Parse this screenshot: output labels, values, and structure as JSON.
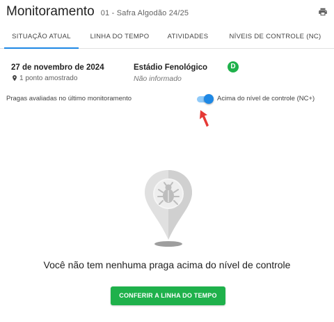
{
  "header": {
    "title": "Monitoramento",
    "subtitle": "01 - Safra Algodão 24/25",
    "print_icon": "printer-icon"
  },
  "tabs": [
    {
      "label": "SITUAÇÃO ATUAL",
      "active": true
    },
    {
      "label": "LINHA DO TEMPO",
      "active": false
    },
    {
      "label": "ATIVIDADES",
      "active": false
    },
    {
      "label": "NÍVEIS DE CONTROLE (NC)",
      "active": false
    }
  ],
  "summary": {
    "date": "27 de novembro de 2024",
    "points": "1 ponto amostrado",
    "points_icon": "map-pin-icon",
    "stage_label": "Estádio Fenológico",
    "stage_value": "Não informado",
    "stage_badge": "D"
  },
  "filter": {
    "pests_label": "Pragas avaliadas no último monitoramento",
    "toggle_label": "Acima do nível de controle (NC+)",
    "toggle_on": true
  },
  "empty_state": {
    "icon": "bug-location-pin-icon",
    "message": "Você não tem nenhuma praga acima do nível de controle",
    "button_label": "CONFERIR A LINHA DO TEMPO"
  },
  "colors": {
    "accent": "#1e88e5",
    "green": "#1fb14b",
    "annotation_arrow": "#e53935"
  }
}
